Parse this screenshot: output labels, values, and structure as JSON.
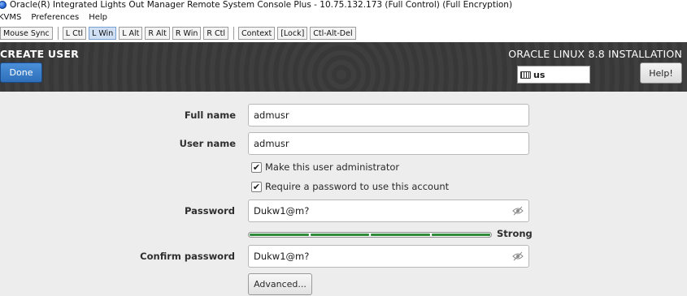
{
  "window": {
    "title": "Oracle(R) Integrated Lights Out Manager Remote System Console Plus - 10.75.132.173 (Full Control) (Full Encryption)"
  },
  "menubar": {
    "items": [
      "KVMS",
      "Preferences",
      "Help"
    ]
  },
  "toolbar": {
    "mouse_sync": "Mouse Sync",
    "keys": [
      "L Ctl",
      "L Win",
      "L Alt",
      "R Alt",
      "R Win",
      "R Ctl"
    ],
    "active_key": "L Win",
    "context": "Context",
    "lock": "[Lock]",
    "ctl_alt_del": "Ctl-Alt-Del"
  },
  "header": {
    "spoke_title": "CREATE USER",
    "done_label": "Done",
    "product_title": "ORACLE LINUX 8.8 INSTALLATION",
    "keyboard_layout": "us",
    "help_label": "Help!"
  },
  "form": {
    "full_name_label": "Full name",
    "full_name_value": "admusr",
    "user_name_label": "User name",
    "user_name_value": "admusr",
    "make_admin_label": "Make this user administrator",
    "make_admin_checked": true,
    "require_password_label": "Require a password to use this account",
    "require_password_checked": true,
    "password_label": "Password",
    "password_value": "Dukw1@m?",
    "strength_level": 1.0,
    "strength_label": "Strong",
    "confirm_label": "Confirm password",
    "confirm_value": "Dukw1@m?",
    "advanced_label": "Advanced..."
  },
  "colors": {
    "header_bg": "#3a3a3a",
    "done_blue": "#2f6fb9",
    "strength_green": "#2e8b3a",
    "content_bg": "#ededed"
  }
}
